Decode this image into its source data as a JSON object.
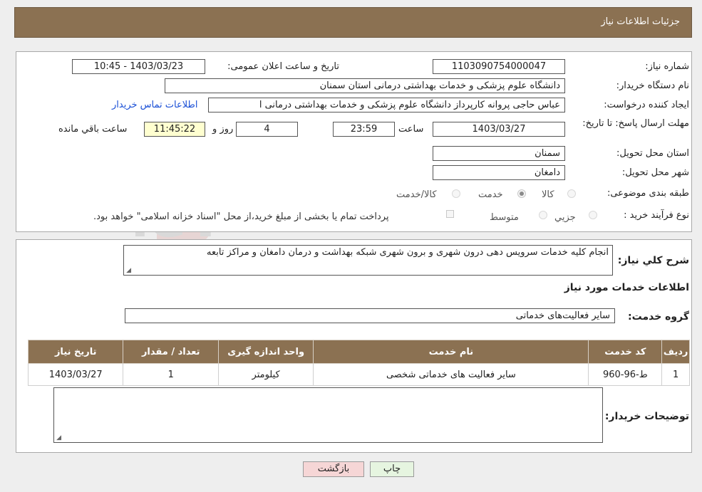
{
  "header": {
    "title": "جزئیات اطلاعات نیاز"
  },
  "form": {
    "need_number_label": "شماره نیاز:",
    "need_number": "1103090754000047",
    "announce_label": "تاریخ و ساعت اعلان عمومی:",
    "announce_value": "1403/03/23 - 10:45",
    "buyer_label": "نام دستگاه خریدار:",
    "buyer_value": "دانشگاه علوم پزشکی و خدمات بهداشتی  درمانی استان سمنان",
    "creator_label": "ایجاد کننده درخواست:",
    "creator_value": "عباس حاجی پروانه کارپرداز دانشگاه علوم پزشکی و خدمات بهداشتی  درمانی ا",
    "contact_link": "اطلاعات تماس خریدار",
    "deadline_label": "مهلت ارسال پاسخ: تا تاریخ:",
    "deadline_date": "1403/03/27",
    "time_label": "ساعت",
    "deadline_time": "23:59",
    "days_value": "4",
    "days_label": "روز و",
    "remaining_value": "11:45:22",
    "remaining_label": "ساعت باقي مانده",
    "province_label": "استان محل تحویل:",
    "province_value": "سمنان",
    "city_label": "شهر محل تحویل:",
    "city_value": "دامغان",
    "category_label": "طبقه بندی موضوعی:",
    "category_options": [
      "کالا",
      "خدمت",
      "کالا/خدمت"
    ],
    "category_selected": "خدمت",
    "process_label": "نوع فرآیند خرید :",
    "process_options": [
      "جزیي",
      "متوسط"
    ],
    "payment_note": "پرداخت تمام یا بخشی از مبلغ خرید،از محل \"اسناد خزانه اسلامی\" خواهد بود."
  },
  "details": {
    "summary_label": "شرح کلي نياز:",
    "summary_value": "انجام کلیه خدمات سرویس دهی درون شهری و برون شهری شبکه بهداشت و درمان دامغان و مراکز تابعه",
    "services_heading": "اطلاعات خدمات مورد نياز",
    "service_group_label": "گروه خدمت:",
    "service_group_value": "سایر فعالیت‌های خدماتی",
    "table": {
      "headers": [
        "رديف",
        "کد خدمت",
        "نام خدمت",
        "واحد اندازه گيری",
        "تعداد / مقدار",
        "تاریخ نياز"
      ],
      "rows": [
        [
          "1",
          "ط-96-960",
          "سایر فعالیت های خدماتی شخصی",
          "کیلومتر",
          "1",
          "1403/03/27"
        ]
      ]
    },
    "buyer_notes_label": "توضيحات خريدار:",
    "buyer_notes_value": ""
  },
  "buttons": {
    "print": "چاپ",
    "back": "بازگشت"
  },
  "watermark_text": "AriaTender.neT",
  "colors": {
    "header_bg": "#8b7152",
    "link": "#1a4fd6",
    "back_button_bg": "#f6d6d6",
    "print_button_bg": "#e6f5e0"
  }
}
